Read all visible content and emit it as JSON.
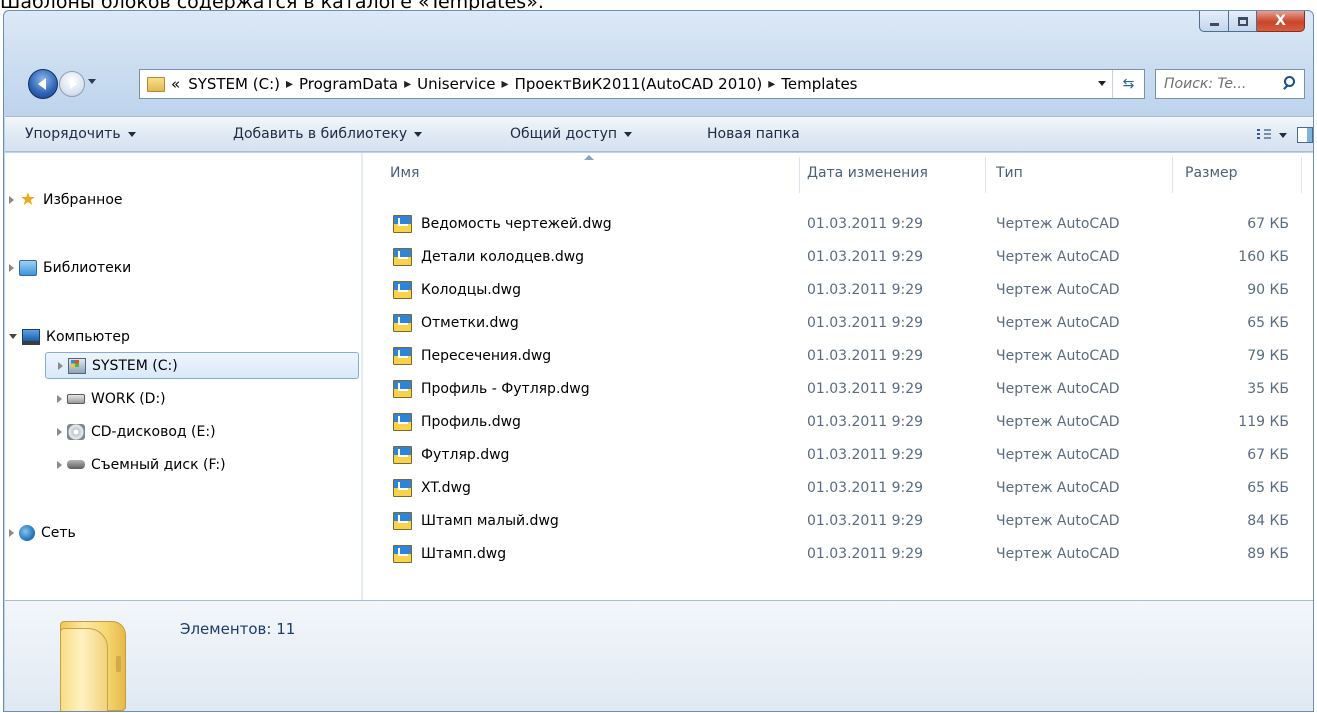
{
  "caption": "Шаблоны блоков содержатся в каталоге «Templates».",
  "window_controls": {
    "close_glyph": "X"
  },
  "address": {
    "prefix": "«",
    "crumbs": [
      "SYSTEM (C:)",
      "ProgramData",
      "Uniservice",
      "ПроектВиК2011(AutoCAD 2010)",
      "Templates"
    ],
    "chevron": "▸"
  },
  "search": {
    "placeholder": "Поиск: Te..."
  },
  "commands": {
    "organize": "Упорядочить",
    "add_to_library": "Добавить в библиотеку",
    "share": "Общий доступ",
    "new_folder": "Новая папка"
  },
  "nav": {
    "favorites": "Избранное",
    "libraries": "Библиотеки",
    "computer": "Компьютер",
    "drives": [
      "SYSTEM (C:)",
      "WORK (D:)",
      "CD-дисковод (E:)",
      "Съемный диск (F:)"
    ],
    "network": "Сеть"
  },
  "columns": {
    "name": "Имя",
    "date": "Дата изменения",
    "type": "Тип",
    "size": "Размер"
  },
  "files": [
    {
      "name": "Ведомость чертежей.dwg",
      "date": "01.03.2011 9:29",
      "type": "Чертеж AutoCAD",
      "size": "67 КБ"
    },
    {
      "name": "Детали колодцев.dwg",
      "date": "01.03.2011 9:29",
      "type": "Чертеж AutoCAD",
      "size": "160 КБ"
    },
    {
      "name": "Колодцы.dwg",
      "date": "01.03.2011 9:29",
      "type": "Чертеж AutoCAD",
      "size": "90 КБ"
    },
    {
      "name": "Отметки.dwg",
      "date": "01.03.2011 9:29",
      "type": "Чертеж AutoCAD",
      "size": "65 КБ"
    },
    {
      "name": "Пересечения.dwg",
      "date": "01.03.2011 9:29",
      "type": "Чертеж AutoCAD",
      "size": "79 КБ"
    },
    {
      "name": "Профиль - Футляр.dwg",
      "date": "01.03.2011 9:29",
      "type": "Чертеж AutoCAD",
      "size": "35 КБ"
    },
    {
      "name": "Профиль.dwg",
      "date": "01.03.2011 9:29",
      "type": "Чертеж AutoCAD",
      "size": "119 КБ"
    },
    {
      "name": "Футляр.dwg",
      "date": "01.03.2011 9:29",
      "type": "Чертеж AutoCAD",
      "size": "67 КБ"
    },
    {
      "name": "XT.dwg",
      "date": "01.03.2011 9:29",
      "type": "Чертеж AutoCAD",
      "size": "65 КБ"
    },
    {
      "name": "Штамп малый.dwg",
      "date": "01.03.2011 9:29",
      "type": "Чертеж AutoCAD",
      "size": "84 КБ"
    },
    {
      "name": "Штамп.dwg",
      "date": "01.03.2011 9:29",
      "type": "Чертеж AutoCAD",
      "size": "89 КБ"
    }
  ],
  "status": {
    "item_count": "Элементов: 11"
  },
  "icons": {
    "back": "back-arrow-icon",
    "forward": "forward-arrow-icon",
    "search": "search-icon",
    "refresh": "refresh-icon",
    "favorites": "star-icon",
    "file": "dwg-file-icon",
    "help": "help-icon",
    "folder": "folder-icon"
  },
  "colors": {
    "window_frame": "#bcd3ec",
    "selection": "#d8e9f9",
    "details_text": "#1c3d6e"
  }
}
